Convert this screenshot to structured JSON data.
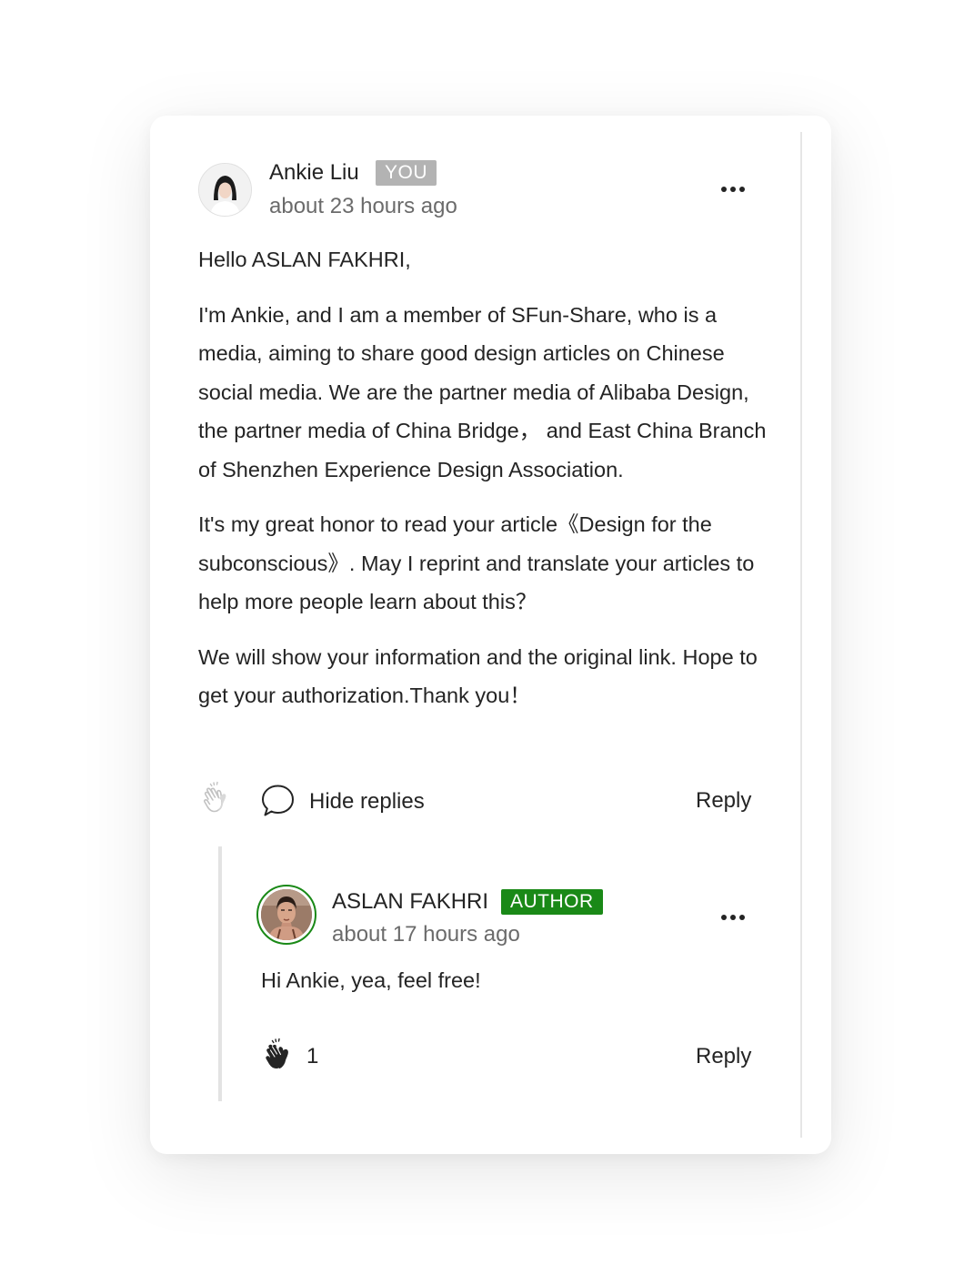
{
  "comment": {
    "author": "Ankie Liu",
    "badge": "YOU",
    "timestamp": "about 23 hours ago",
    "paragraphs": [
      "Hello ASLAN FAKHRI,",
      "I'm Ankie, and I am a member of SFun-Share, who is a media, aiming to share good design articles on Chinese social media. We are the partner media of Alibaba Design, the partner media of China Bridge， and East China Branch of Shenzhen Experience Design Association.",
      "It's my great honor to read your article《Design for the subconscious》. May I reprint and translate your articles to help more people learn about this？",
      "We will show your information and the original link. Hope to get your authorization.Thank you！"
    ],
    "hide_replies_label": "Hide replies",
    "reply_label": "Reply"
  },
  "reply": {
    "author": "ASLAN FAKHRI",
    "badge": "AUTHOR",
    "timestamp": "about 17 hours ago",
    "body": "Hi Ankie, yea, feel free!",
    "clap_count": "1",
    "reply_label": "Reply"
  },
  "colors": {
    "author_badge": "#1a8917",
    "you_badge": "#b3b3b3",
    "muted_text": "#6b6b6b"
  },
  "icons": {
    "clap_inactive": "clap-outline-icon",
    "clap_active": "clap-filled-icon",
    "responses": "speech-bubble-icon",
    "more": "more-horizontal-icon"
  }
}
